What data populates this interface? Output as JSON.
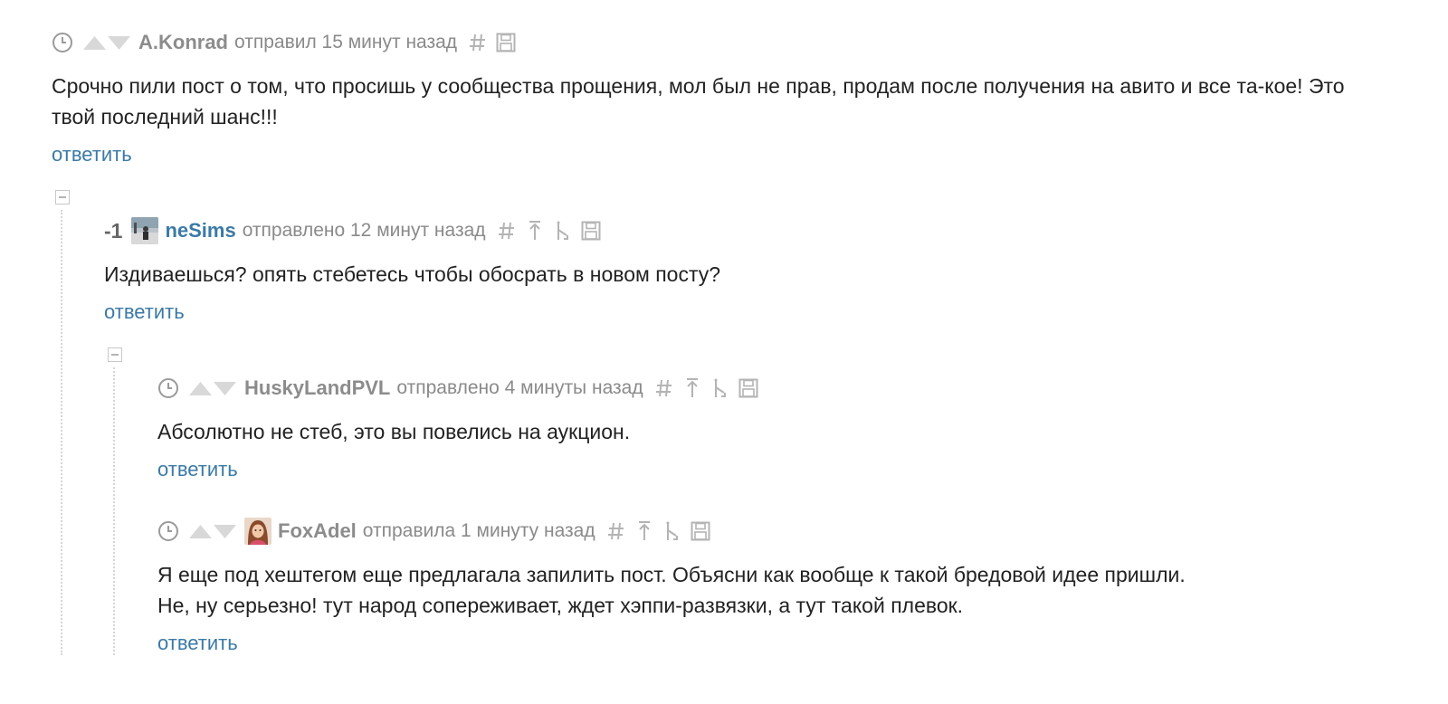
{
  "comments": [
    {
      "author": "A.Konrad",
      "posted": "отправил 15 минут назад",
      "text": "Срочно пили пост о том, что просишь у сообщества прощения, мол был не прав, продам после получения на авито и все та-кое! Это твой последний шанс!!!",
      "reply": "ответить"
    },
    {
      "rating": "-1",
      "author": "neSims",
      "posted": "отправлено 12 минут назад",
      "text": "Издиваешься? опять стебетесь чтобы обосрать в новом посту?",
      "reply": "ответить"
    },
    {
      "author": "HuskyLandPVL",
      "posted": "отправлено 4 минуты назад",
      "text": "Абсолютно не стеб, это вы повелись на аукцион.",
      "reply": "ответить"
    },
    {
      "author": "FoxAdel",
      "posted": "отправила 1 минуту назад",
      "text_line1": "Я еще под хештегом еще предлагала запилить пост. Объясни как вообще к такой бредовой идее пришли.",
      "text_line2": "Не, ну серьезно! тут народ сопереживает, ждет хэппи-развязки, а тут такой плевок.",
      "reply": "ответить"
    }
  ],
  "icons": {
    "clock": "clock-icon",
    "vote_up": "vote-up-icon",
    "vote_down": "vote-down-icon",
    "link": "hash-icon",
    "go_parent": "go-to-parent-icon",
    "go_branch": "go-to-branch-icon",
    "save": "save-icon",
    "collapse": "collapse-icon"
  },
  "colors": {
    "link": "#3b7aa6",
    "meta": "#8a8a8a",
    "text": "#222222",
    "icon": "#bcbcbc"
  }
}
